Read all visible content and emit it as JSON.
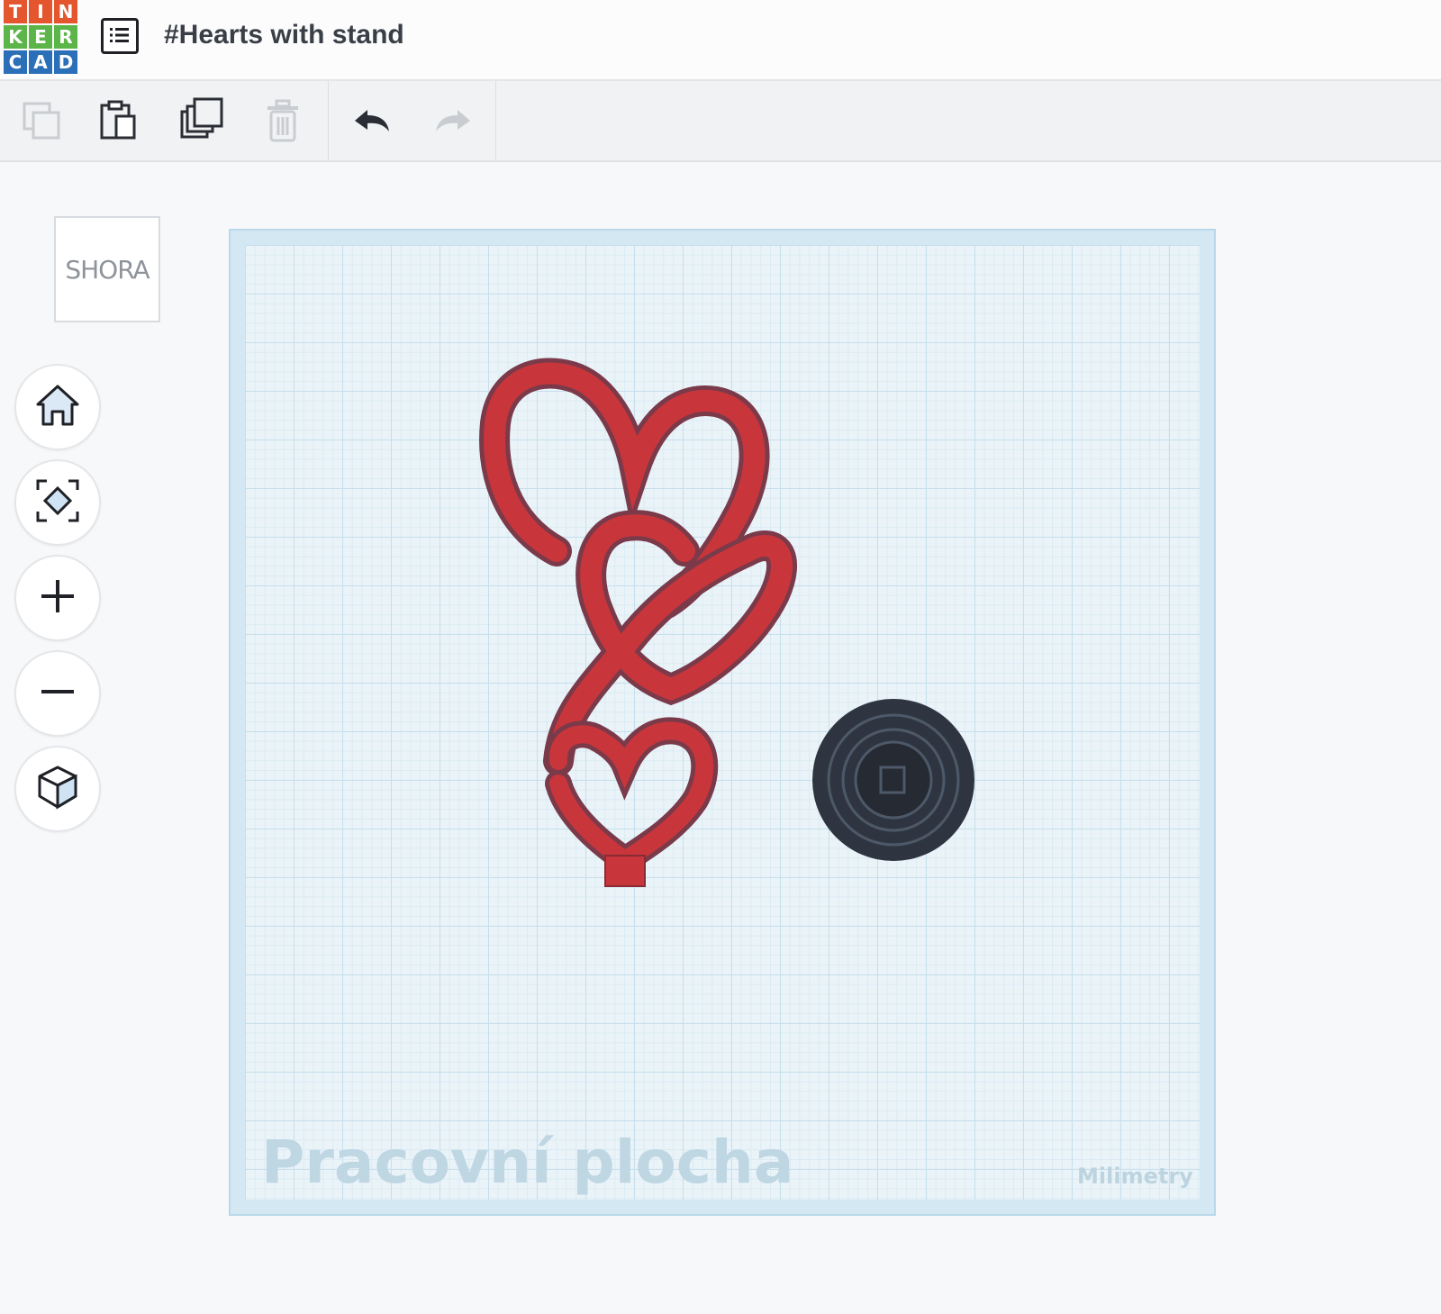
{
  "header": {
    "logo_letters": [
      "T",
      "I",
      "N",
      "K",
      "E",
      "R",
      "C",
      "A",
      "D"
    ],
    "logo_colors": [
      "#e4572e",
      "#e4572e",
      "#e4572e",
      "#5bb548",
      "#5bb548",
      "#5bb548",
      "#2a6fb7",
      "#2a6fb7",
      "#2a6fb7"
    ],
    "design_title": "#Hearts with stand"
  },
  "toolbar": {
    "icons": [
      "copy-icon",
      "paste-icon",
      "duplicate-icon",
      "delete-icon",
      "undo-icon",
      "redo-icon"
    ]
  },
  "viewcube": {
    "label": "SHORA"
  },
  "nav": {
    "icons": [
      "home-icon",
      "fit-view-icon",
      "zoom-in-icon",
      "zoom-out-icon",
      "perspective-cube-icon"
    ]
  },
  "workplane": {
    "label": "Pracovní plocha",
    "units": "Milimetry"
  },
  "colors": {
    "heart_red": "#c8363b",
    "heart_edge": "#7a3a4a",
    "stand_dark": "#2f3540",
    "plane": "#eaf3f8"
  }
}
